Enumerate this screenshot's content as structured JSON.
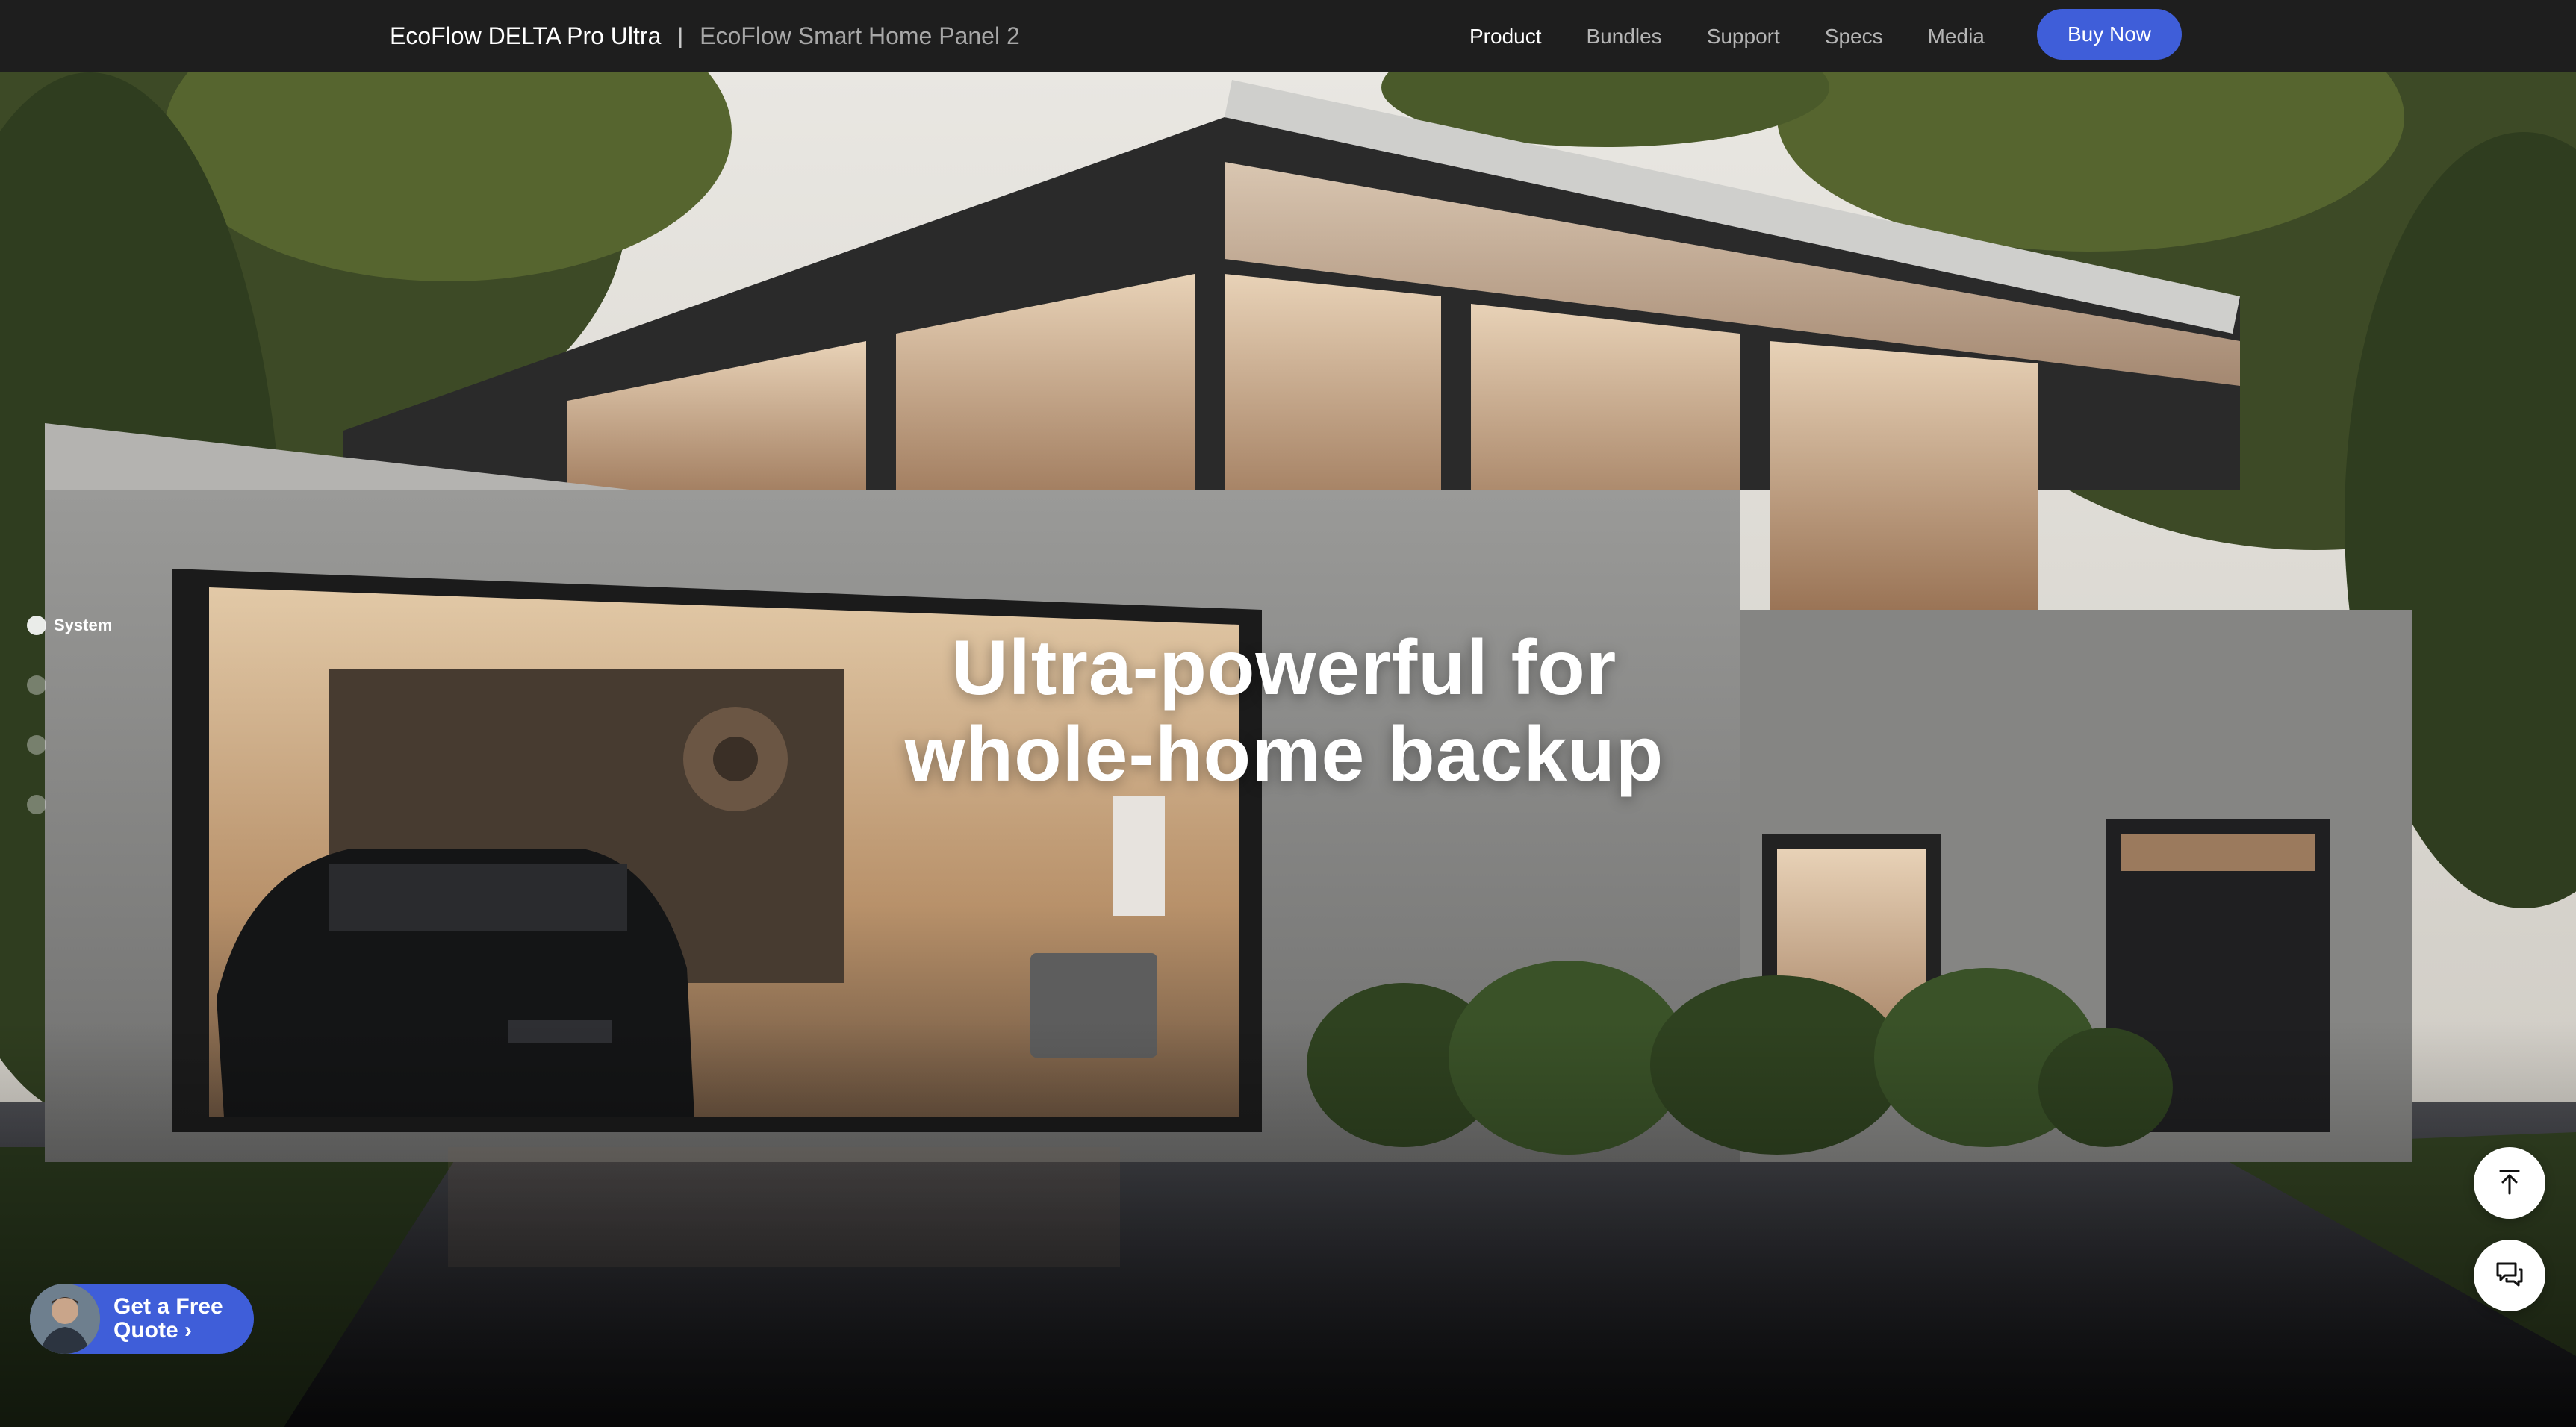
{
  "nav": {
    "brand": "EcoFlow DELTA Pro Ultra",
    "separator": "|",
    "sub_brand": "EcoFlow Smart Home Panel 2",
    "links": [
      "Product",
      "Bundles",
      "Support",
      "Specs",
      "Media"
    ],
    "active_link": "Product",
    "buy_label": "Buy Now"
  },
  "hero": {
    "headline_line1": "Ultra-powerful for",
    "headline_line2": "whole-home backup"
  },
  "section_nav": {
    "active_label": "System",
    "dot_count": 4
  },
  "quote": {
    "line1": "Get a Free",
    "line2": "Quote",
    "arrow": "›"
  },
  "floating": {
    "top_icon": "back-to-top-icon",
    "chat_icon": "chat-icon"
  },
  "colors": {
    "nav_bg": "#1e1e1e",
    "accent": "#3f5ed9"
  }
}
